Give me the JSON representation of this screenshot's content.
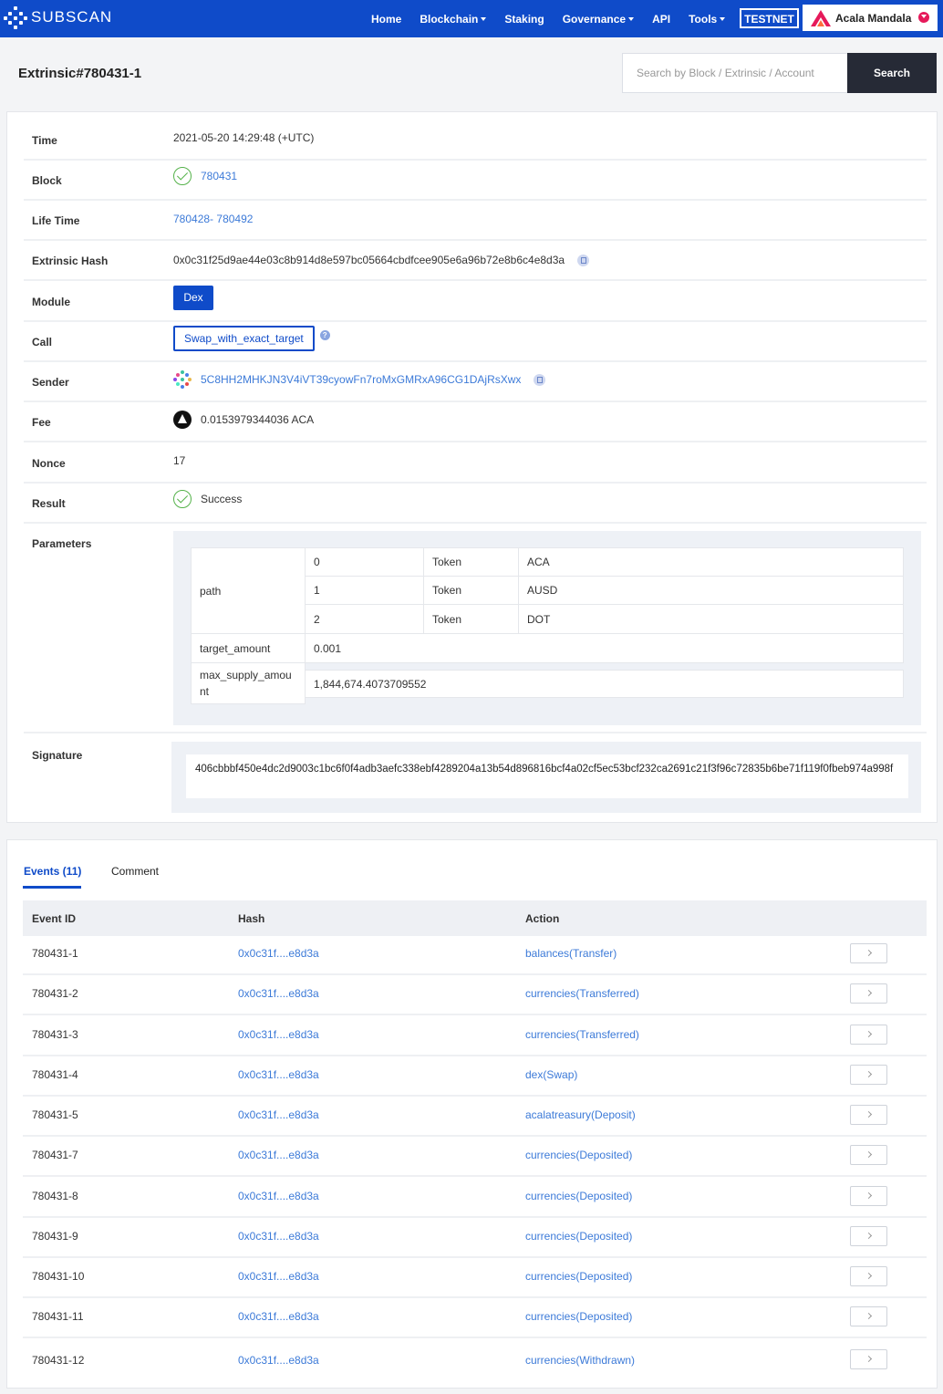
{
  "header": {
    "brand": "SUBSCAN",
    "nav": [
      {
        "label": "Home",
        "dropdown": false
      },
      {
        "label": "Blockchain",
        "dropdown": true
      },
      {
        "label": "Staking",
        "dropdown": false
      },
      {
        "label": "Governance",
        "dropdown": true
      },
      {
        "label": "API",
        "dropdown": false
      },
      {
        "label": "Tools",
        "dropdown": true
      }
    ],
    "testnet_label": "TESTNET",
    "network_name": "Acala Mandala",
    "brand_color": "#0f4bc9",
    "network_accent": "#e6195a"
  },
  "page": {
    "title": "Extrinsic#780431-1",
    "search_placeholder": "Search by Block / Extrinsic / Account",
    "search_button": "Search"
  },
  "details": {
    "time": {
      "label": "Time",
      "value": "2021-05-20 14:29:48 (+UTC)"
    },
    "block": {
      "label": "Block",
      "value": "780431"
    },
    "life_time": {
      "label": "Life Time",
      "start": "780428",
      "separator": "- ",
      "end": "780492"
    },
    "extrinsic_hash": {
      "label": "Extrinsic Hash",
      "value": "0x0c31f25d9ae44e03c8b914d8e597bc05664cbdfcee905e6a96b72e8b6c4e8d3a"
    },
    "module": {
      "label": "Module",
      "value": "Dex"
    },
    "call": {
      "label": "Call",
      "value": "Swap_with_exact_target"
    },
    "sender": {
      "label": "Sender",
      "value": "5C8HH2MHKJN3V4iVT39cyowFn7roMxGMRxA96CG1DAjRsXwx"
    },
    "fee": {
      "label": "Fee",
      "value": "0.0153979344036 ACA"
    },
    "nonce": {
      "label": "Nonce",
      "value": "17"
    },
    "result": {
      "label": "Result",
      "value": "Success"
    },
    "parameters": {
      "label": "Parameters",
      "path_label": "path",
      "path": [
        {
          "index": "0",
          "type": "Token",
          "value": "ACA"
        },
        {
          "index": "1",
          "type": "Token",
          "value": "AUSD"
        },
        {
          "index": "2",
          "type": "Token",
          "value": "DOT"
        }
      ],
      "target_amount_label": "target_amount",
      "target_amount": "0.001",
      "max_supply_label": "max_supply_amou\nnt",
      "max_supply_amount": "1,844,674.4073709552"
    },
    "signature": {
      "label": "Signature",
      "value": "406cbbbf450e4dc2d9003c1bc6f0f4adb3aefc338ebf4289204a13b54d896816bcf4a02cf5ec53bcf232ca2691c21f3f96c72835b6be71f119f0fbeb974a998f"
    }
  },
  "events": {
    "tab_events": "Events (11)",
    "tab_comment": "Comment",
    "columns": {
      "id": "Event ID",
      "hash": "Hash",
      "action": "Action"
    },
    "rows": [
      {
        "id": "780431-1",
        "hash": "0x0c31f....e8d3a",
        "action": "balances(Transfer)"
      },
      {
        "id": "780431-2",
        "hash": "0x0c31f....e8d3a",
        "action": "currencies(Transferred)"
      },
      {
        "id": "780431-3",
        "hash": "0x0c31f....e8d3a",
        "action": "currencies(Transferred)"
      },
      {
        "id": "780431-4",
        "hash": "0x0c31f....e8d3a",
        "action": "dex(Swap)"
      },
      {
        "id": "780431-5",
        "hash": "0x0c31f....e8d3a",
        "action": "acalatreasury(Deposit)"
      },
      {
        "id": "780431-7",
        "hash": "0x0c31f....e8d3a",
        "action": "currencies(Deposited)"
      },
      {
        "id": "780431-8",
        "hash": "0x0c31f....e8d3a",
        "action": "currencies(Deposited)"
      },
      {
        "id": "780431-9",
        "hash": "0x0c31f....e8d3a",
        "action": "currencies(Deposited)"
      },
      {
        "id": "780431-10",
        "hash": "0x0c31f....e8d3a",
        "action": "currencies(Deposited)"
      },
      {
        "id": "780431-11",
        "hash": "0x0c31f....e8d3a",
        "action": "currencies(Deposited)"
      },
      {
        "id": "780431-12",
        "hash": "0x0c31f....e8d3a",
        "action": "currencies(Withdrawn)"
      }
    ]
  }
}
